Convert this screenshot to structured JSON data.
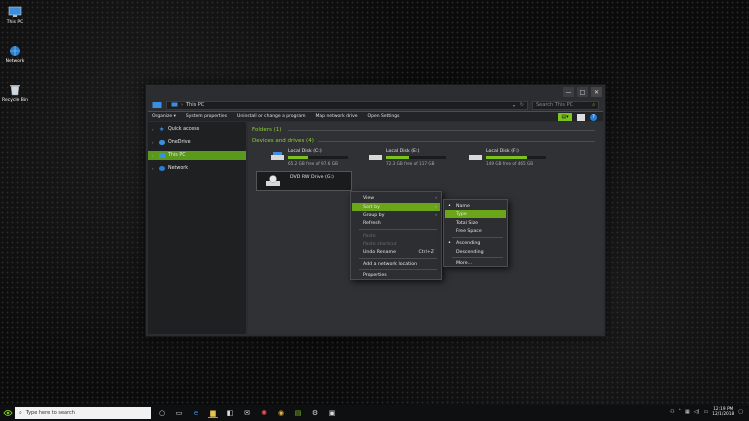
{
  "desktop": {
    "icons": [
      {
        "label": "This PC"
      },
      {
        "label": "Network"
      },
      {
        "label": "Recycle Bin"
      }
    ]
  },
  "window": {
    "controls": {
      "minimize": "—",
      "maximize": "□",
      "close": "✕"
    },
    "address": {
      "location": "This PC",
      "separator": "›"
    },
    "search": {
      "placeholder": "Search This PC"
    },
    "toolbar": {
      "organize": "Organize ▾",
      "items": [
        "System properties",
        "Uninstall or change a program",
        "Map network drive",
        "Open Settings"
      ]
    },
    "nav": {
      "items": [
        {
          "label": "Quick access"
        },
        {
          "label": "OneDrive"
        },
        {
          "label": "This PC"
        },
        {
          "label": "Network"
        }
      ]
    },
    "content": {
      "folders_title": "Folders (1)",
      "drives_title": "Devices and drives (4)",
      "drives": [
        {
          "name": "Local Disk (C:)",
          "free": "65.2 GB free of 97.6 GB",
          "fill": 0.33
        },
        {
          "name": "Local Disk (E:)",
          "free": "72.3 GB free of 117 GB",
          "fill": 0.38
        },
        {
          "name": "Local Disk (F:)",
          "free": "149 GB free of 465 GB",
          "fill": 0.68
        }
      ],
      "dvd": {
        "name": "DVD RW Drive (G:)"
      }
    }
  },
  "context_menu": {
    "items": [
      {
        "label": "View"
      },
      {
        "label": "Sort by"
      },
      {
        "label": "Group by"
      },
      {
        "label": "Refresh"
      },
      {
        "label": "Paste"
      },
      {
        "label": "Paste shortcut"
      },
      {
        "label": "Undo Rename",
        "shortcut": "Ctrl+Z"
      },
      {
        "label": "Add a network location"
      },
      {
        "label": "Properties"
      }
    ]
  },
  "sort_menu": {
    "items": [
      {
        "label": "Name"
      },
      {
        "label": "Type"
      },
      {
        "label": "Total Size"
      },
      {
        "label": "Free Space"
      },
      {
        "label": "Ascending"
      },
      {
        "label": "Descending"
      },
      {
        "label": "More..."
      }
    ]
  },
  "taskbar": {
    "search_placeholder": "Type here to search",
    "time": "12:19 PM",
    "date": "12/1/2018"
  },
  "colors": {
    "accent": "#7cc21e",
    "window_bg": "#2b2d30",
    "nav_bg": "#1f2022"
  }
}
